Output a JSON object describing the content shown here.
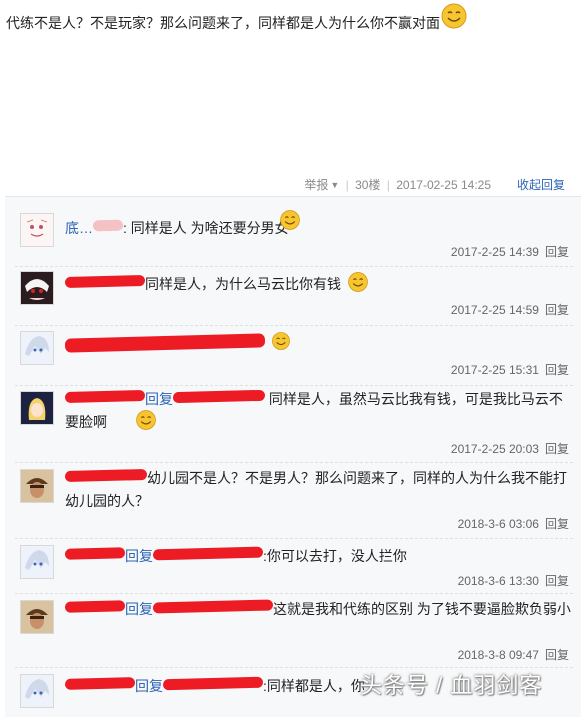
{
  "post": {
    "text": "代练不是人？不是玩家？那么问题来了，同样都是人为什么你不赢对面",
    "emoji": "smiley-face"
  },
  "meta": {
    "report_label": "举报",
    "floor": "30楼",
    "timestamp": "2017-02-25 14:25",
    "collapse_label": "收起回复"
  },
  "replies": [
    {
      "user": "底…",
      "text": "同样是人 为啥还要分男女",
      "time": "2017-2-25 14:39",
      "reply_label": "回复",
      "avatar": "sketch-avatar"
    },
    {
      "user": "",
      "text": "同样是人，为什么马云比你有钱",
      "time": "2017-2-25 14:59",
      "reply_label": "回复",
      "avatar": "white-hair-avatar"
    },
    {
      "user": "",
      "text": "",
      "time": "2017-2-25 15:31",
      "reply_label": "回复",
      "avatar": "anime-avatar"
    },
    {
      "user": "",
      "mid": "回复",
      "text": "同样是人，虽然马云比我有钱，可是我比马云不要脸啊",
      "time": "2017-2-25 20:03",
      "reply_label": "回复",
      "avatar": "blonde-avatar"
    },
    {
      "user": "",
      "text": "幼儿园不是人？不是男人？那么问题来了，同样的人为什么我不能打幼儿园的人？",
      "time": "2018-3-6 03:06",
      "reply_label": "回复",
      "avatar": "soldier-avatar"
    },
    {
      "user": "",
      "mid": "回复",
      "text": "你可以去打，没人拦你",
      "time": "2018-3-6 13:30",
      "reply_label": "回复",
      "avatar": "anime-avatar"
    },
    {
      "user": "",
      "mid": "回复",
      "text": "这就是我和代练的区别 为了钱不要逼脸欺负弱小",
      "time": "2018-3-8 09:47",
      "reply_label": "回复",
      "avatar": "soldier-avatar"
    },
    {
      "user": "",
      "mid": "回复",
      "text": "同样都是人，你",
      "time": "",
      "reply_label": "",
      "avatar": "anime-avatar"
    }
  ],
  "watermark": "头条号 / 血羽剑客"
}
